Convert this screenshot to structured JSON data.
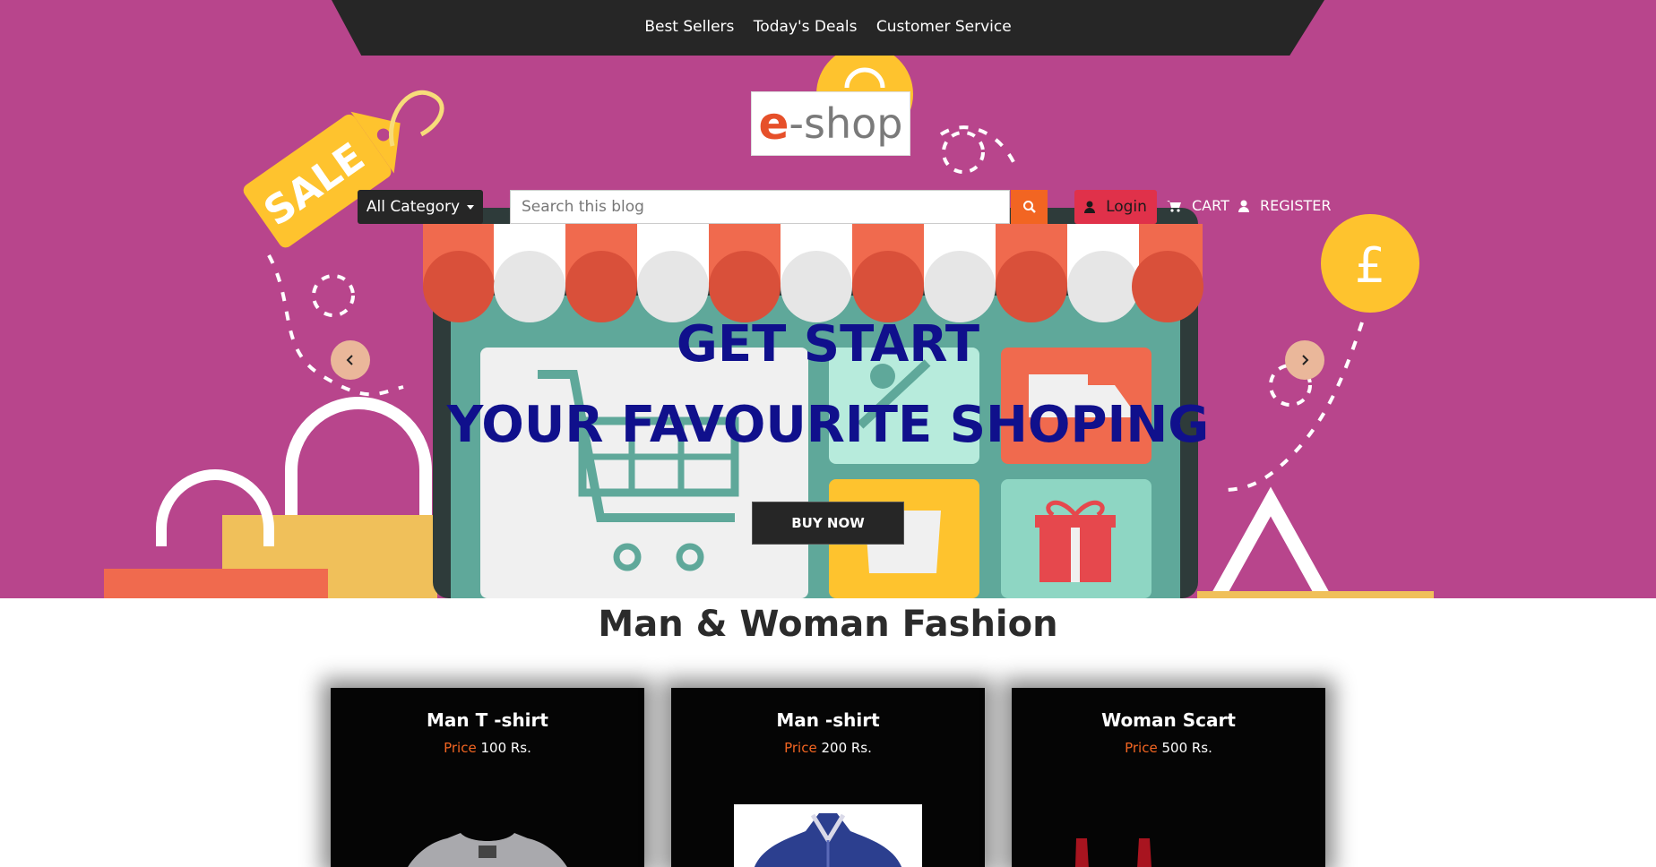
{
  "topnav": {
    "links": [
      "Best Sellers",
      "Today's Deals",
      "Customer Service"
    ]
  },
  "logo": {
    "e": "e",
    "rest": "-shop"
  },
  "search_bar": {
    "category_label": "All Category",
    "placeholder": "Search this blog",
    "login_label": "Login",
    "cart_label": "CART",
    "register_label": "REGISTER"
  },
  "hero": {
    "line1": "GET START",
    "line2": "YOUR FAVOURITE SHOPING",
    "button_label": "BUY NOW"
  },
  "section": {
    "title": "Man & Woman Fashion"
  },
  "products": [
    {
      "name": "Man T -shirt",
      "price_label": "Price",
      "price_value": "100 Rs."
    },
    {
      "name": "Man -shirt",
      "price_label": "Price",
      "price_value": "200 Rs."
    },
    {
      "name": "Woman Scart",
      "price_label": "Price",
      "price_value": "500 Rs."
    }
  ],
  "colors": {
    "hero_bg": "#b8458c",
    "nav_bg": "#262626",
    "accent_orange": "#f26522",
    "login_red": "#e0314a",
    "headline_blue": "#10108c"
  }
}
